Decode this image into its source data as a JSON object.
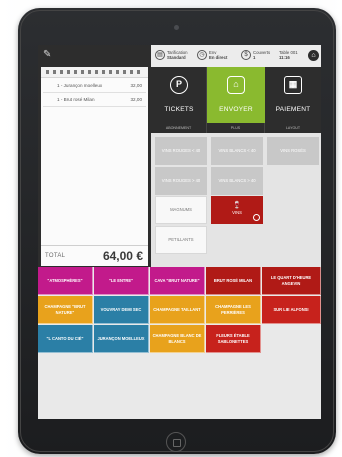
{
  "colors": {
    "accent_green": "#8aba2f",
    "dark": "#2d2d2d",
    "wine_red": "#b01a16",
    "magenta": "#c21a8b",
    "teal": "#2b7fa6",
    "orange": "#e8a21c",
    "red": "#c7221c"
  },
  "icons": {
    "edit": "edit-icon",
    "tarification": "tag-icon",
    "service": "clock-icon",
    "covers": "dollar-icon",
    "home": "home-icon",
    "tickets": "receipt-icon",
    "envoyer": "send-icon",
    "paiement": "calculator-icon",
    "wine": "wine-glass-icon",
    "check": "check-icon"
  },
  "receipt": {
    "header": "En direct",
    "items": [
      {
        "name": "1 - Jurançon moelleux",
        "price": "32,00"
      },
      {
        "name": "1 - Brut rosé Milan",
        "price": "32,00"
      }
    ],
    "total_label": "TOTAL",
    "total_value": "64,00 €"
  },
  "topbar": {
    "tarification_label": "Tarification",
    "tarification_value": "Standard",
    "service_label": "Env",
    "service_value": "En direct",
    "covers_label": "Couverts",
    "covers_value": "1",
    "table_label": "Table 001",
    "table_value": "11:16"
  },
  "actions": {
    "tickets": "TICKETS",
    "envoyer": "ENVOYER",
    "paiement": "PAIEMENT"
  },
  "subtabs": [
    "ABONNEMENT",
    "PLUS",
    "LAYOUT"
  ],
  "categories": [
    "VINS ROUGES < 40",
    "VINS BLANCS < 40",
    "VINS ROSÉS",
    "VINS ROUGES > 40",
    "VINS BLANCS > 40",
    "MAGNUMS",
    "VINS",
    "PETILLANTS"
  ],
  "products": [
    "\"ATMOSPHÈRES\"",
    "\"LE ENTRE\"",
    "CAVA \"BRUT NATURE\"",
    "BRUT ROSÉ MILAN",
    "LE QUART D'HEURE ANGEVIN",
    "CHAMPAGNE \"BRUT NATURE\"",
    "VOUVRAY DEMI SEC",
    "CHAMPAGNE TAILLANT",
    "CHAMPAGNE LES PERRIÈRES",
    "SUR LIE ALFONSI",
    "\"L CANTO DU CIÉ\"",
    "JURANÇON MOELLEUX",
    "CHAMPAGNE BLANC DE BLANCS",
    "FLEURS ÉTABLE SABLONETTES"
  ]
}
